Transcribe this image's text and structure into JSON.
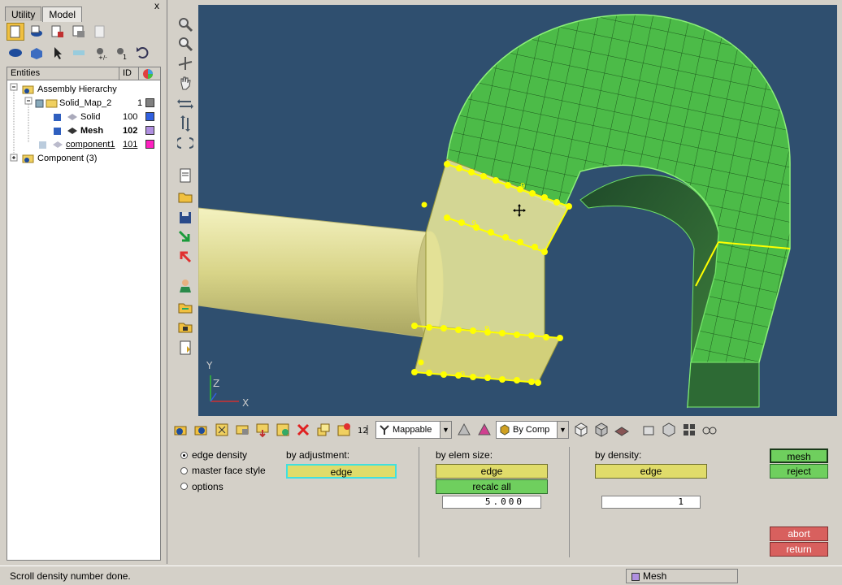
{
  "tabs": [
    {
      "label": "Utility"
    },
    {
      "label": "Model"
    }
  ],
  "close_label": "x",
  "tree": {
    "columns": [
      "Entities",
      "ID"
    ],
    "rows": [
      {
        "label": "Assembly Hierarchy",
        "id": "",
        "color": ""
      },
      {
        "label": "Solid_Map_2",
        "id": "1",
        "color": "#808080"
      },
      {
        "label": "Solid",
        "id": "100",
        "color": "#3060e0"
      },
      {
        "label": "Mesh",
        "id": "102",
        "color": "#b090e0"
      },
      {
        "label": "component1",
        "id": "101",
        "color": "#ff20c0"
      },
      {
        "label": "Component (3)",
        "id": "",
        "color": ""
      }
    ]
  },
  "viewport": {
    "bg": "#2f4f6f",
    "mesh_color": "#4cbb48",
    "solid_color": "#e8e6a0",
    "edge_color": "#ffff00",
    "axes": {
      "y": "Y",
      "z": "Z",
      "x": "X"
    },
    "density_label": "9"
  },
  "toolbar": {
    "mode_combo": "Mappable",
    "color_combo": "By Comp"
  },
  "panel": {
    "options": [
      {
        "label": "edge density",
        "selected": true
      },
      {
        "label": "master face style",
        "selected": false
      },
      {
        "label": "options",
        "selected": false
      }
    ],
    "by_adjustment": {
      "title": "by adjustment:",
      "edge_label": "edge"
    },
    "by_elem_size": {
      "title": "by elem size:",
      "edge_label": "edge",
      "recalc_label": "recalc all",
      "value": "5.000"
    },
    "by_density": {
      "title": "by density:",
      "edge_label": "edge",
      "value": "1"
    },
    "mesh_label": "mesh",
    "reject_label": "reject",
    "abort_label": "abort",
    "return_label": "return"
  },
  "status": {
    "message": "Scroll density number done.",
    "component": "Mesh"
  }
}
